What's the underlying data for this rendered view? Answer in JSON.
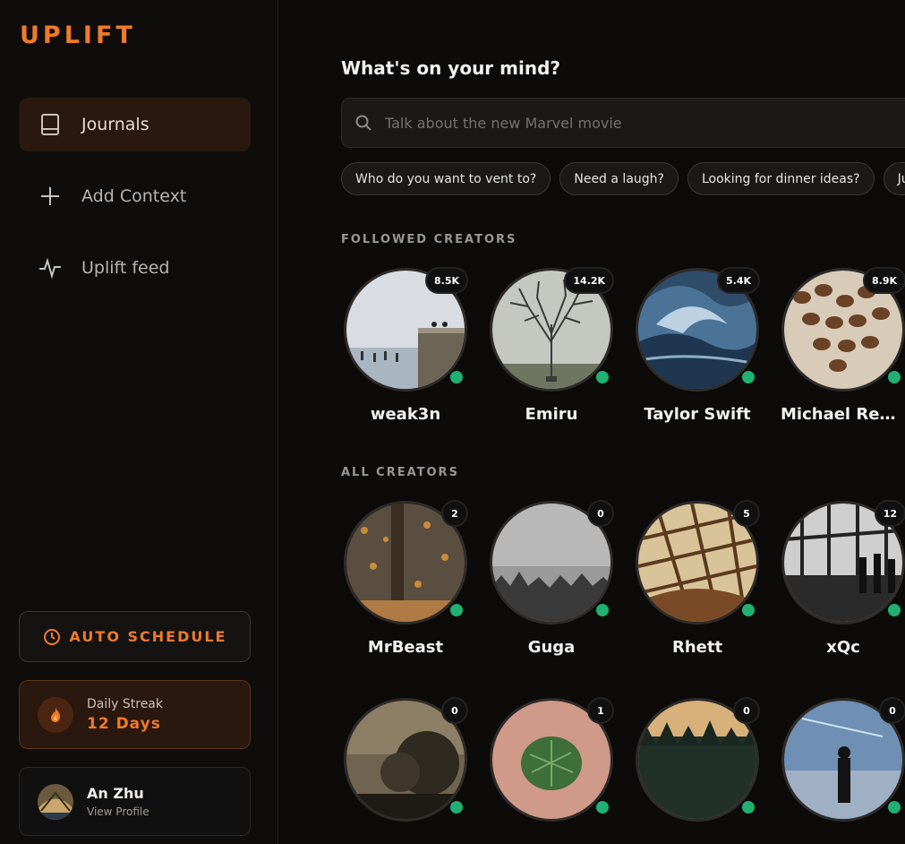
{
  "app": {
    "logo": "UPLIFT",
    "accent": "#f07a2a",
    "online_color": "#1fb072"
  },
  "sidebar": {
    "items": [
      {
        "label": "Journals",
        "icon": "book-icon",
        "active": true
      },
      {
        "label": "Add Context",
        "icon": "plus-icon",
        "active": false
      },
      {
        "label": "Uplift feed",
        "icon": "activity-icon",
        "active": false
      }
    ],
    "auto_schedule": {
      "label": "AUTO SCHEDULE",
      "icon": "clock-icon"
    },
    "streak": {
      "label": "Daily Streak",
      "value": "12 Days",
      "icon": "flame-icon"
    },
    "profile": {
      "name": "An Zhu",
      "link": "View Profile"
    }
  },
  "main": {
    "heading": "What's on your mind?",
    "search": {
      "placeholder": "Talk about the new Marvel movie",
      "value": ""
    },
    "chips": [
      "Who do you want to vent to?",
      "Need a laugh?",
      "Looking for dinner ideas?",
      "Ju"
    ],
    "followed_title": "FOLLOWED CREATORS",
    "followed": [
      {
        "name": "weak3n",
        "count": "8.5K",
        "online": true
      },
      {
        "name": "Emiru",
        "count": "14.2K",
        "online": true
      },
      {
        "name": "Taylor Swift",
        "count": "5.4K",
        "online": true
      },
      {
        "name": "Michael Reev...",
        "count": "8.9K",
        "online": true
      }
    ],
    "all_title": "ALL CREATORS",
    "all": [
      {
        "name": "MrBeast",
        "count": "2",
        "online": true
      },
      {
        "name": "Guga",
        "count": "0",
        "online": true
      },
      {
        "name": "Rhett",
        "count": "5",
        "online": true
      },
      {
        "name": "xQc",
        "count": "12",
        "online": true
      },
      {
        "name": "",
        "count": "0",
        "online": true
      },
      {
        "name": "",
        "count": "1",
        "online": true
      },
      {
        "name": "",
        "count": "0",
        "online": true
      },
      {
        "name": "",
        "count": "0",
        "online": true
      }
    ]
  }
}
